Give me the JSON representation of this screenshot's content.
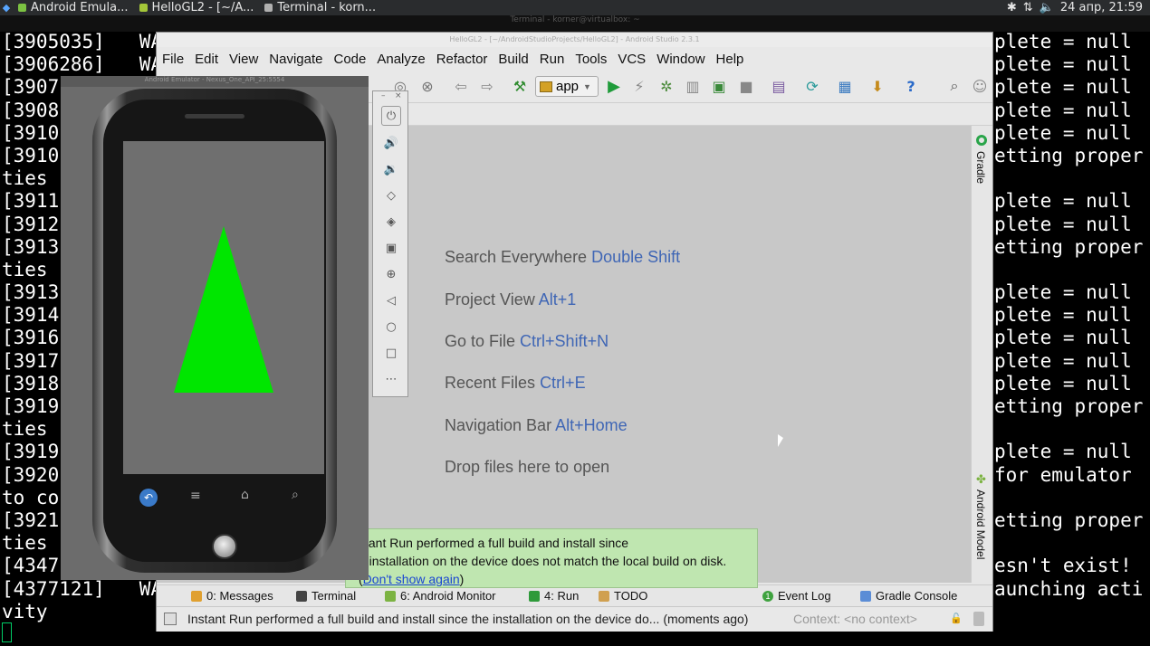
{
  "panel": {
    "tasks": [
      {
        "label": "Android Emula...",
        "color": "#7cc242"
      },
      {
        "label": "HelloGL2 - [~/A...",
        "color": "#a4c639"
      },
      {
        "label": "Terminal - korn...",
        "color": "#b0b0b0"
      }
    ],
    "clock": "24 апр, 21:59",
    "tray_icons": [
      "bluetooth-icon",
      "network-icon",
      "volume-icon"
    ]
  },
  "terminal": {
    "title": "Terminal - korner@virtualbox: ~",
    "lines": [
      "[3905035]   WA",
      "[3906286]   WA",
      "[3907",
      "[3908",
      "[3910",
      "[3910",
      "ties ",
      "[3911",
      "[3912",
      "[3913",
      "ties ",
      "[3913",
      "[3914",
      "[3916",
      "[3917",
      "[3918",
      "[3919",
      "ties ",
      "[3919",
      "[3920",
      "to co",
      "[3921",
      "ties ",
      "[4347",
      "[4377121]   WA",
      "vity"
    ],
    "right_lines": [
      "plete = null",
      "plete = null",
      "plete = null",
      "plete = null",
      "plete = null",
      "etting proper",
      "",
      "plete = null",
      "plete = null",
      "etting proper",
      "",
      "plete = null",
      "plete = null",
      "plete = null",
      "plete = null",
      "plete = null",
      "etting proper",
      "",
      "plete = null",
      "for emulator",
      "",
      "etting proper",
      "",
      "esn't exist!",
      "aunching acti",
      ""
    ]
  },
  "studio": {
    "title": "HelloGL2 - [~/AndroidStudioProjects/HelloGL2] - Android Studio 2.3.1",
    "menu": [
      "File",
      "Edit",
      "View",
      "Navigate",
      "Code",
      "Analyze",
      "Refactor",
      "Build",
      "Run",
      "Tools",
      "VCS",
      "Window",
      "Help"
    ],
    "run_config": "app",
    "hints": [
      {
        "text": "Search Everywhere",
        "key": "Double Shift"
      },
      {
        "text": "Project View",
        "key": "Alt+1"
      },
      {
        "text": "Go to File",
        "key": "Ctrl+Shift+N"
      },
      {
        "text": "Recent Files",
        "key": "Ctrl+E"
      },
      {
        "text": "Navigation Bar",
        "key": "Alt+Home"
      },
      {
        "text": "Drop files here to open",
        "key": ""
      }
    ],
    "side_tabs": {
      "gradle": "Gradle",
      "android_model": "Android Model"
    },
    "tool_windows": [
      {
        "label": "0: Messages",
        "color": "#e0a030"
      },
      {
        "label": "Terminal",
        "color": "#444444"
      },
      {
        "label": "6: Android Monitor",
        "color": "#7cb342"
      },
      {
        "label": "4: Run",
        "color": "#2e9a3a"
      },
      {
        "label": "TODO",
        "color": "#d0a050"
      },
      {
        "label": "Event Log",
        "color": "#3fa23f"
      },
      {
        "label": "Gradle Console",
        "color": "#5b8dd6"
      }
    ],
    "event_badge": "1",
    "balloon": {
      "line1": "stant Run performed a full build and install since",
      "line2": "e installation on the device does not match the local build on disk.",
      "link": "Don't show again",
      "open_paren": "(",
      "close_paren": ")"
    },
    "status": {
      "message": "Instant Run performed a full build and install since the installation on the device do... (moments ago)",
      "context": "Context: <no context>"
    }
  },
  "emulator": {
    "title": "Android Emulator - Nexus_One_API_25:5554",
    "triangle_color": "#00e600",
    "controls": [
      "power-icon",
      "volume-up-icon",
      "volume-down-icon",
      "rotate-left-icon",
      "rotate-right-icon",
      "camera-icon",
      "zoom-icon",
      "back-icon",
      "home-icon",
      "overview-icon",
      "more-icon"
    ]
  }
}
